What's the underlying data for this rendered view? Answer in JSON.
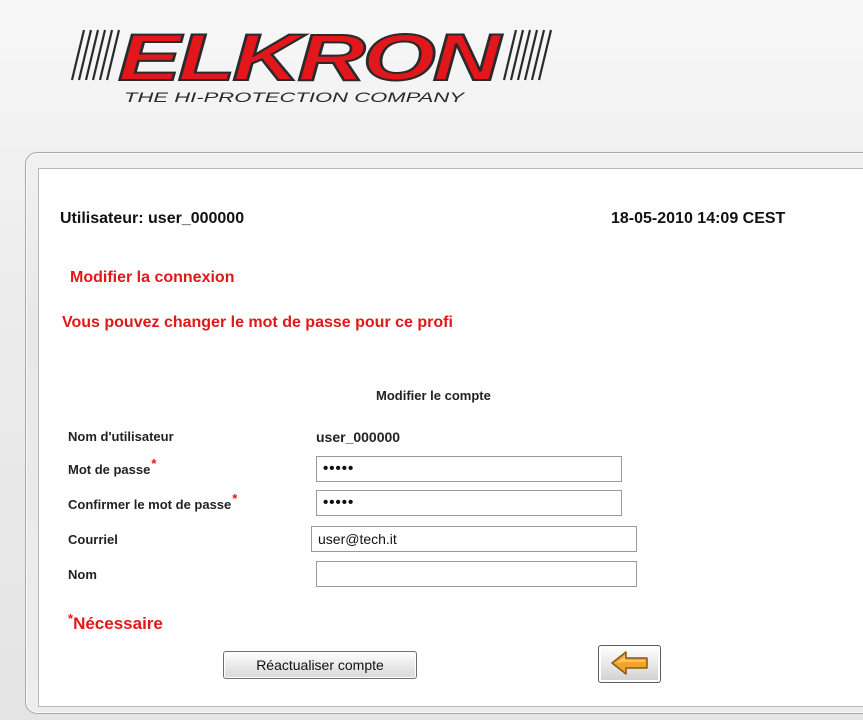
{
  "brand": {
    "name": "ELKRON",
    "tagline": "THE HI-PROTECTION COMPANY",
    "color_red": "#e3161c",
    "color_dark": "#2a2a2a"
  },
  "header": {
    "user_label": "Utilisateur: user_000000",
    "datetime": "18-05-2010 14:09 CEST"
  },
  "titles": {
    "heading": "Modifier la connexion",
    "subheading": "Vous pouvez changer le mot de passe pour ce profi"
  },
  "form": {
    "heading": "Modifier le compte",
    "username_label": "Nom d'utilisateur",
    "username_value": "user_000000",
    "password_label": "Mot de passe",
    "password_value": "•••••",
    "confirm_label": "Confirmer le mot de passe",
    "confirm_value": "•••••",
    "email_label": "Courriel",
    "email_value": "user@tech.it",
    "name_label": "Nom",
    "name_value": "",
    "required_star": "*",
    "required_note": "Nécessaire"
  },
  "buttons": {
    "update_label": "Réactualiser compte",
    "back_icon": "left-arrow-icon",
    "arrow_color": "#f2a32a"
  }
}
